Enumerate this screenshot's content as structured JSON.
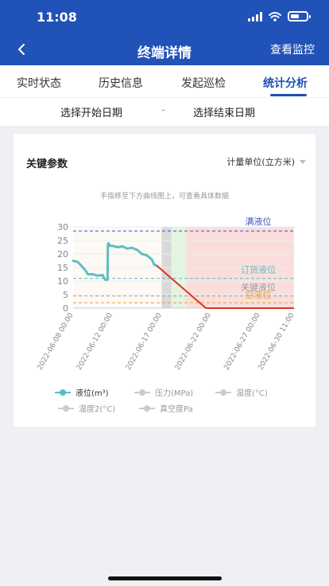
{
  "status_bar": {
    "time": "11:08"
  },
  "header": {
    "title": "终端详情",
    "right_action": "查看监控"
  },
  "tabs": [
    {
      "label": "实时状态"
    },
    {
      "label": "历史信息"
    },
    {
      "label": "发起巡检"
    },
    {
      "label": "统计分析",
      "active": true
    }
  ],
  "date_range": {
    "start": "选择开始日期",
    "separator": "-",
    "end": "选择结束日期"
  },
  "card": {
    "title": "关键参数",
    "unit_select": "计量单位(立方米)",
    "hint": "手指移至下方曲线图上，可查看具体数据"
  },
  "colors": {
    "brand": "#2152b8",
    "series": "#5bbec4",
    "forecast": "#e0341e"
  },
  "chart_data": {
    "type": "line",
    "ylim": [
      0,
      30
    ],
    "yticks": [
      0,
      5,
      10,
      15,
      20,
      25,
      30
    ],
    "xticks": [
      "2022-06-08 00:00",
      "2022-06-12 00:00",
      "2022-06-17 00:00",
      "2022-06-22 00:00",
      "2022-06-27 00:00",
      "2022-06-30 11:00"
    ],
    "xrange": [
      "2022-06-08 00:00",
      "2022-06-30 11:00"
    ],
    "series": [
      {
        "name": "液位(m³)",
        "x": [
          "2022-06-08 00:00",
          "2022-06-08 12:00",
          "2022-06-09 00:00",
          "2022-06-09 06:00",
          "2022-06-09 12:00",
          "2022-06-10 00:00",
          "2022-06-10 12:00",
          "2022-06-11 00:00",
          "2022-06-11 06:00",
          "2022-06-11 12:00",
          "2022-06-11 13:00",
          "2022-06-11 14:00",
          "2022-06-11 18:00",
          "2022-06-12 00:00",
          "2022-06-12 12:00",
          "2022-06-13 00:00",
          "2022-06-13 12:00",
          "2022-06-14 00:00",
          "2022-06-14 12:00",
          "2022-06-15 00:00",
          "2022-06-15 12:00",
          "2022-06-16 00:00",
          "2022-06-16 06:00",
          "2022-06-16 12:00"
        ],
        "values": [
          17.5,
          17,
          15,
          14,
          12.5,
          12.5,
          12,
          12.2,
          10.5,
          10.5,
          23.5,
          24,
          23,
          23,
          22.5,
          22.8,
          22,
          22.3,
          21.5,
          20,
          19.5,
          18,
          16,
          15.7
        ]
      },
      {
        "name": "预测",
        "x": [
          "2022-06-16 12:00",
          "2022-06-21 12:00",
          "2022-06-30 11:00"
        ],
        "values": [
          15.7,
          0,
          0
        ]
      }
    ],
    "reference_lines": [
      {
        "label": "满液位",
        "value": 28.5,
        "color": "#3b55c9"
      },
      {
        "label": "订货液位",
        "value": 11,
        "color": "#5bbec4"
      },
      {
        "label": "关键液位",
        "value": 4.5,
        "color": "#9a9a9a"
      },
      {
        "label": "空液位",
        "value": 2,
        "color": "#e8a23a"
      }
    ],
    "bands": [
      {
        "from": "2022-06-17 00:00",
        "to": "2022-06-18 00:00",
        "color": "#d9d9d9"
      },
      {
        "from": "2022-06-18 00:00",
        "to": "2022-06-19 12:00",
        "color": "#e3f4e1"
      },
      {
        "from": "2022-06-19 12:00",
        "to": "2022-06-30 11:00",
        "color": "#f9dedc"
      }
    ]
  },
  "legend": [
    {
      "label": "液位(m³)",
      "active": true
    },
    {
      "label": "压力(MPa)",
      "active": false
    },
    {
      "label": "温度(°C)",
      "active": false
    },
    {
      "label": "温度2(°C)",
      "active": false
    },
    {
      "label": "真空度Pa",
      "active": false
    }
  ]
}
